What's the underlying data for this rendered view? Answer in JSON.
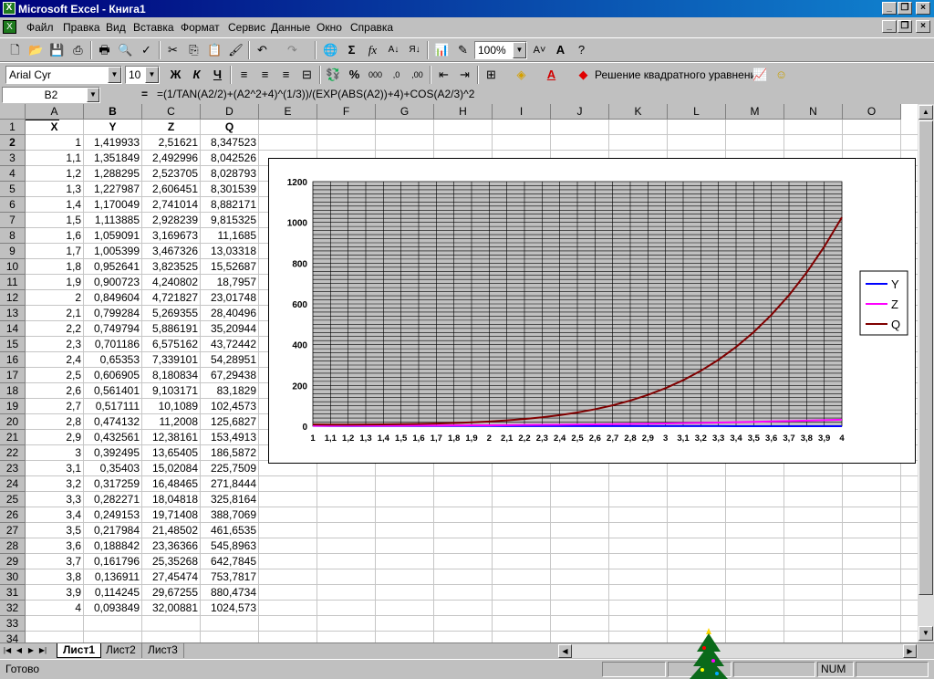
{
  "window": {
    "title": "Microsoft Excel - Книга1"
  },
  "menu": [
    "Файл",
    "Правка",
    "Вид",
    "Вставка",
    "Формат",
    "Сервис",
    "Данные",
    "Окно",
    "Справка"
  ],
  "toolbar": {
    "zoom": "100%",
    "font_name": "Arial Cyr",
    "font_size": "10",
    "macro_label": "Решение квадратного уравнения"
  },
  "formula_bar": {
    "name_box": "B2",
    "equals": "=",
    "formula": "=(1/TAN(A2/2)+(A2^2+4)^(1/3))/(EXP(ABS(A2))+4)+COS(A2/3)^2"
  },
  "columns": [
    "A",
    "B",
    "C",
    "D",
    "E",
    "F",
    "G",
    "H",
    "I",
    "J",
    "K",
    "L",
    "M",
    "N",
    "O"
  ],
  "header_row": [
    "X",
    "Y",
    "Z",
    "Q"
  ],
  "table_rows": [
    [
      "1",
      "1,419933",
      "2,51621",
      "8,347523"
    ],
    [
      "1,1",
      "1,351849",
      "2,492996",
      "8,042526"
    ],
    [
      "1,2",
      "1,288295",
      "2,523705",
      "8,028793"
    ],
    [
      "1,3",
      "1,227987",
      "2,606451",
      "8,301539"
    ],
    [
      "1,4",
      "1,170049",
      "2,741014",
      "8,882171"
    ],
    [
      "1,5",
      "1,113885",
      "2,928239",
      "9,815325"
    ],
    [
      "1,6",
      "1,059091",
      "3,169673",
      "11,1685"
    ],
    [
      "1,7",
      "1,005399",
      "3,467326",
      "13,03318"
    ],
    [
      "1,8",
      "0,952641",
      "3,823525",
      "15,52687"
    ],
    [
      "1,9",
      "0,900723",
      "4,240802",
      "18,7957"
    ],
    [
      "2",
      "0,849604",
      "4,721827",
      "23,01748"
    ],
    [
      "2,1",
      "0,799284",
      "5,269355",
      "28,40496"
    ],
    [
      "2,2",
      "0,749794",
      "5,886191",
      "35,20944"
    ],
    [
      "2,3",
      "0,701186",
      "6,575162",
      "43,72442"
    ],
    [
      "2,4",
      "0,65353",
      "7,339101",
      "54,28951"
    ],
    [
      "2,5",
      "0,606905",
      "8,180834",
      "67,29438"
    ],
    [
      "2,6",
      "0,561401",
      "9,103171",
      "83,1829"
    ],
    [
      "2,7",
      "0,517111",
      "10,1089",
      "102,4573"
    ],
    [
      "2,8",
      "0,474132",
      "11,2008",
      "125,6827"
    ],
    [
      "2,9",
      "0,432561",
      "12,38161",
      "153,4913"
    ],
    [
      "3",
      "0,392495",
      "13,65405",
      "186,5872"
    ],
    [
      "3,1",
      "0,35403",
      "15,02084",
      "225,7509"
    ],
    [
      "3,2",
      "0,317259",
      "16,48465",
      "271,8444"
    ],
    [
      "3,3",
      "0,282271",
      "18,04818",
      "325,8164"
    ],
    [
      "3,4",
      "0,249153",
      "19,71408",
      "388,7069"
    ],
    [
      "3,5",
      "0,217984",
      "21,48502",
      "461,6535"
    ],
    [
      "3,6",
      "0,188842",
      "23,36366",
      "545,8963"
    ],
    [
      "3,7",
      "0,161796",
      "25,35268",
      "642,7845"
    ],
    [
      "3,8",
      "0,136911",
      "27,45474",
      "753,7817"
    ],
    [
      "3,9",
      "0,114245",
      "29,67255",
      "880,4734"
    ],
    [
      "4",
      "0,093849",
      "32,00881",
      "1024,573"
    ]
  ],
  "row_numbers": [
    "1",
    "2",
    "3",
    "4",
    "5",
    "6",
    "7",
    "8",
    "9",
    "10",
    "11",
    "12",
    "13",
    "14",
    "15",
    "16",
    "17",
    "18",
    "19",
    "20",
    "21",
    "22",
    "23",
    "24",
    "25",
    "26",
    "27",
    "28",
    "29",
    "30",
    "31",
    "32",
    "33",
    "34"
  ],
  "sheet_tabs": [
    "Лист1",
    "Лист2",
    "Лист3"
  ],
  "status": {
    "ready": "Готово",
    "num": "NUM"
  },
  "colors": {
    "Y": "#0000ff",
    "Z": "#ff00ff",
    "Q": "#800000",
    "plot_bg": "#c0c0c0",
    "title_bar": "#00007b"
  },
  "chart_data": {
    "type": "line",
    "x": [
      1,
      1.1,
      1.2,
      1.3,
      1.4,
      1.5,
      1.6,
      1.7,
      1.8,
      1.9,
      2,
      2.1,
      2.2,
      2.3,
      2.4,
      2.5,
      2.6,
      2.7,
      2.8,
      2.9,
      3,
      3.1,
      3.2,
      3.3,
      3.4,
      3.5,
      3.6,
      3.7,
      3.8,
      3.9,
      4
    ],
    "x_tick_labels": [
      "1",
      "1,1",
      "1,2",
      "1,3",
      "1,4",
      "1,5",
      "1,6",
      "1,7",
      "1,8",
      "1,9",
      "2",
      "2,1",
      "2,2",
      "2,3",
      "2,4",
      "2,5",
      "2,6",
      "2,7",
      "2,8",
      "2,9",
      "3",
      "3,1",
      "3,2",
      "3,3",
      "3,4",
      "3,5",
      "3,6",
      "3,7",
      "3,8",
      "3,9",
      "4"
    ],
    "y_ticks": [
      0,
      200,
      400,
      600,
      800,
      1000,
      1200
    ],
    "ylim": [
      0,
      1200
    ],
    "grid": true,
    "legend": "right",
    "series": [
      {
        "name": "Y",
        "values": [
          1.419933,
          1.351849,
          1.288295,
          1.227987,
          1.170049,
          1.113885,
          1.059091,
          1.005399,
          0.952641,
          0.900723,
          0.849604,
          0.799284,
          0.749794,
          0.701186,
          0.65353,
          0.606905,
          0.561401,
          0.517111,
          0.474132,
          0.432561,
          0.392495,
          0.35403,
          0.317259,
          0.282271,
          0.249153,
          0.217984,
          0.188842,
          0.161796,
          0.136911,
          0.114245,
          0.093849
        ]
      },
      {
        "name": "Z",
        "values": [
          2.51621,
          2.492996,
          2.523705,
          2.606451,
          2.741014,
          2.928239,
          3.169673,
          3.467326,
          3.823525,
          4.240802,
          4.721827,
          5.269355,
          5.886191,
          6.575162,
          7.339101,
          8.180834,
          9.103171,
          10.1089,
          11.2008,
          12.38161,
          13.65405,
          15.02084,
          16.48465,
          18.04818,
          19.71408,
          21.48502,
          23.36366,
          25.35268,
          27.45474,
          29.67255,
          32.00881
        ]
      },
      {
        "name": "Q",
        "values": [
          8.347523,
          8.042526,
          8.028793,
          8.301539,
          8.882171,
          9.815325,
          11.1685,
          13.03318,
          15.52687,
          18.7957,
          23.01748,
          28.40496,
          35.20944,
          43.72442,
          54.28951,
          67.29438,
          83.1829,
          102.4573,
          125.6827,
          153.4913,
          186.5872,
          225.7509,
          271.8444,
          325.8164,
          388.7069,
          461.6535,
          545.8963,
          642.7845,
          753.7817,
          880.4734,
          1024.573
        ]
      }
    ]
  }
}
